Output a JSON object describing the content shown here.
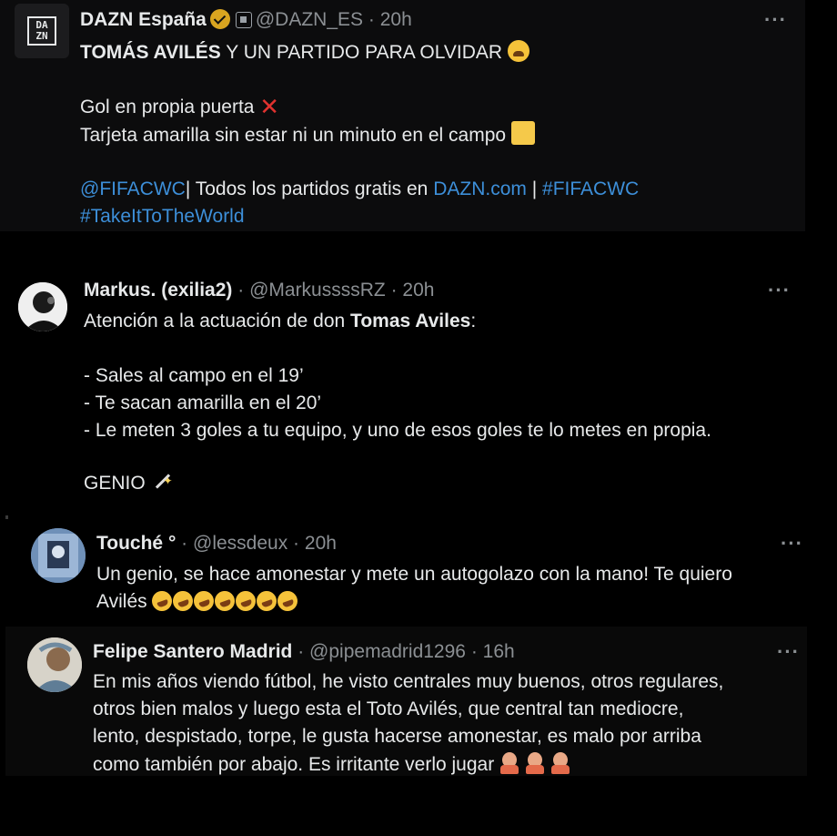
{
  "tweets": [
    {
      "name": "DAZN España",
      "handle": "@DAZN_ES",
      "sep": " · ",
      "time": "20h",
      "logo_text": "DA ZN",
      "line1_bold": "TOMÁS AVILÉS",
      "line1_rest": " Y UN PARTIDO PARA OLVIDAR ",
      "line2": "Gol en propia puerta ",
      "line3": "Tarjeta amarilla sin estar ni un minuto en el campo ",
      "line4_link1": "@FIFACWC",
      "line4_mid": "| Todos los partidos gratis en ",
      "line4_link2": "DAZN.com",
      "line4_sep": " | ",
      "line4_link3": "#FIFACWC",
      "line5_link": "#TakeItToTheWorld"
    },
    {
      "name": "Markus. (exilia2)",
      "handle": "@MarkussssRZ",
      "sep": " · ",
      "time": "20h",
      "line1_pre": "Atención a la actuación de don ",
      "line1_bold": "Tomas Aviles",
      "line1_post": ":",
      "line2": "- Sales al campo en el 19’",
      "line3": "- Te sacan amarilla en el 20’",
      "line4": "- Le meten 3 goles a tu equipo, y uno de esos goles te lo metes en propia.",
      "line5": "GENIO "
    },
    {
      "name": "Touché °",
      "handle": "@lessdeux",
      "sep": " · ",
      "time": "20h",
      "line1": "Un genio, se hace amonestar y mete un autogolazo con la mano! Te quiero",
      "line2": "Avilés "
    },
    {
      "name": "Felipe Santero Madrid",
      "handle": "@pipemadrid1296",
      "sep": " · ",
      "time": "16h",
      "line1": "En mis años viendo fútbol, he visto centrales muy buenos, otros regulares,",
      "line2": "otros bien malos y luego esta el Toto Avilés, que central tan mediocre,",
      "line3": "lento, despistado, torpe, le gusta hacerse amonestar, es malo por arriba",
      "line4": "como también por abajo. Es irritante verlo jugar "
    }
  ],
  "more_label": "···",
  "icons": [
    "verified-badge-icon",
    "affiliate-badge-icon",
    "weary-face-emoji",
    "cross-mark-emoji",
    "yellow-square-emoji",
    "magic-wand-emoji",
    "rofl-emoji",
    "facepalm-emoji",
    "more-icon"
  ],
  "colors": {
    "background": "#000000",
    "text": "#e7e9ea",
    "muted": "#8b8f93",
    "link": "#3d8fd9",
    "verified": "#d9a520"
  }
}
